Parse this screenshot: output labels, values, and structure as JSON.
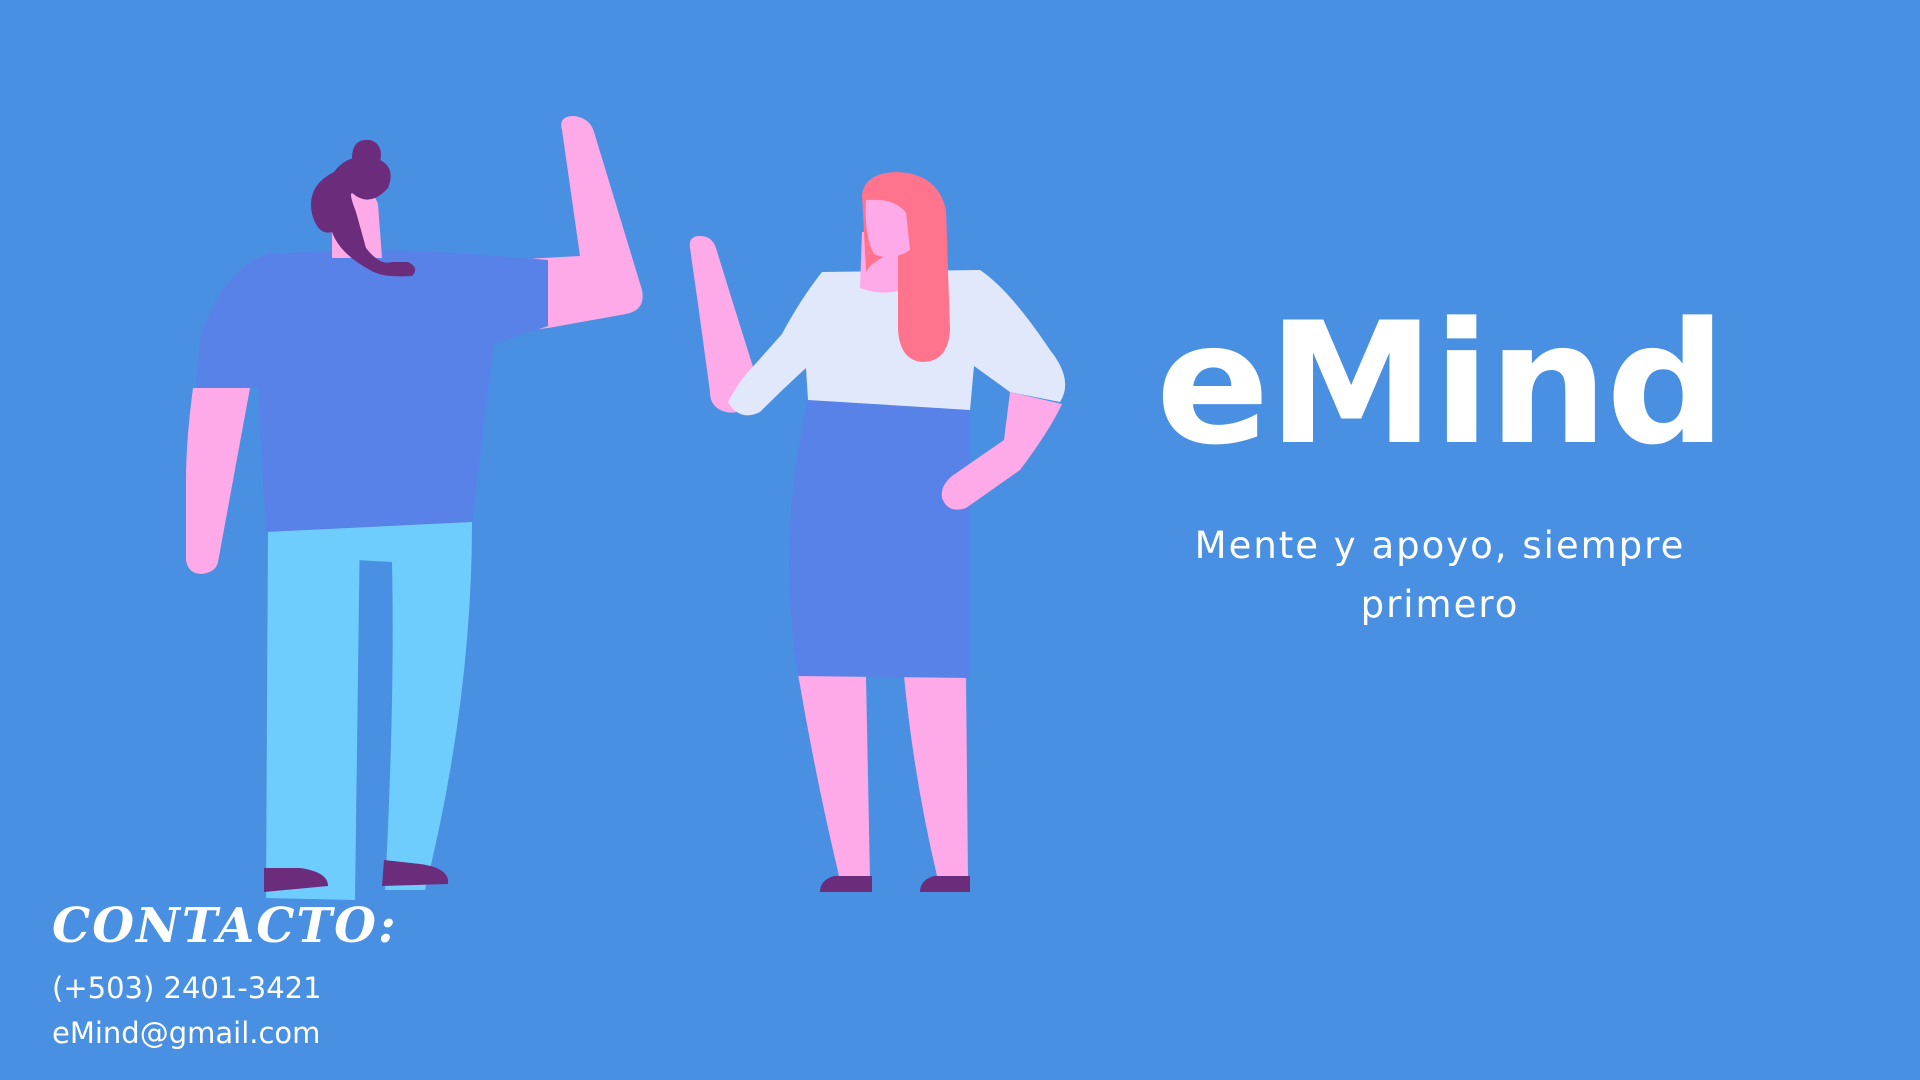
{
  "brand": {
    "title": "eMind",
    "tagline": "Mente y apoyo, siempre primero"
  },
  "contact": {
    "heading": "CONTACTO:",
    "phone": "(+503) 2401-3421",
    "email": "eMind@gmail.com"
  },
  "colors": {
    "background": "#4a90e2",
    "text": "#ffffff",
    "shirt_blue": "#5882e8",
    "skin_pink": "#ffaae8",
    "pants_cyan": "#6ecdfd",
    "hair_purple": "#6c2c7c",
    "hair_coral": "#ff748c",
    "blouse_light": "#e2e8fc"
  },
  "illustration": {
    "figures": [
      "man-waving",
      "woman-waving"
    ]
  }
}
